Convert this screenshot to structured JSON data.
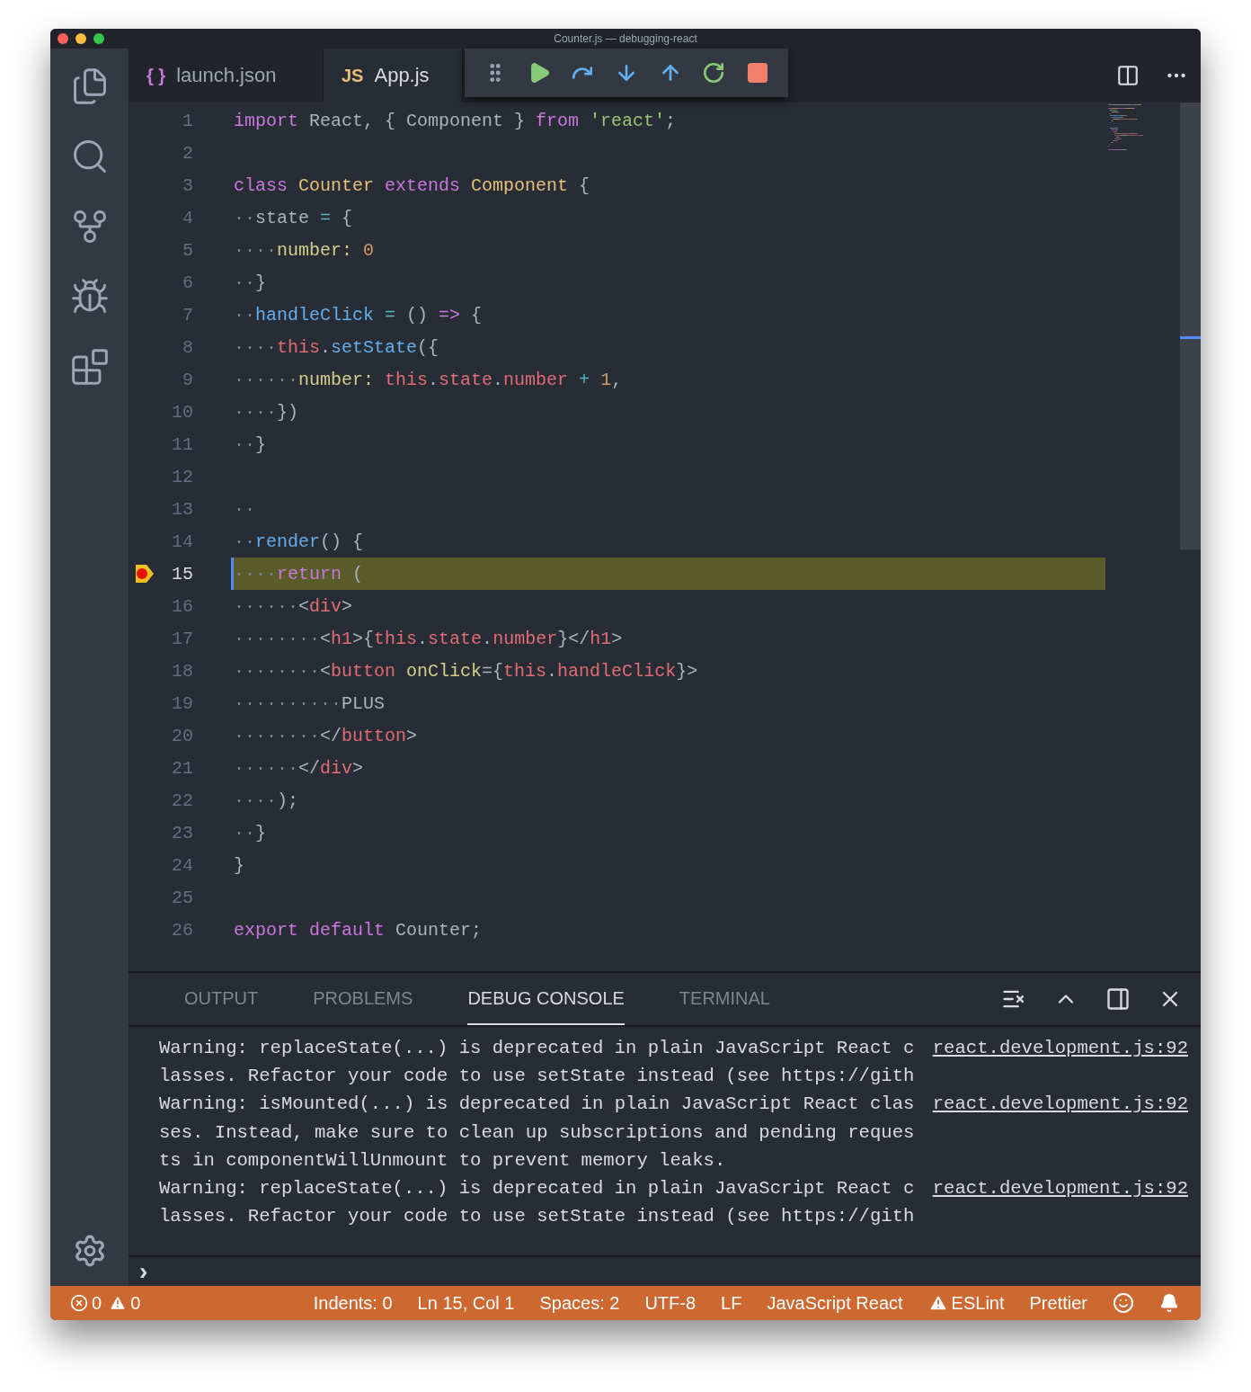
{
  "window": {
    "title": "Counter.js — debugging-react"
  },
  "activity_bar": {
    "items": [
      {
        "kind": "files",
        "selected": false
      },
      {
        "kind": "search",
        "selected": false
      },
      {
        "kind": "git",
        "selected": false
      },
      {
        "kind": "debug",
        "selected": false
      },
      {
        "kind": "extensions",
        "selected": false
      }
    ]
  },
  "tabs": [
    {
      "icon": "{ }",
      "label": "launch.json",
      "kind": "json",
      "selected": false
    },
    {
      "icon": "JS",
      "label": "App.js",
      "kind": "js",
      "selected": true
    }
  ],
  "debug_toolbar": [
    {
      "kind": "grip"
    },
    {
      "kind": "continue"
    },
    {
      "kind": "step-over"
    },
    {
      "kind": "step-into"
    },
    {
      "kind": "step-out"
    },
    {
      "kind": "restart"
    },
    {
      "kind": "stop"
    }
  ],
  "editor": {
    "lines": [
      {
        "number": "1",
        "breakpoint": false,
        "current": false,
        "tokens": [
          {
            "text": "import",
            "kind": "kw"
          },
          {
            "text": " React, { Component } ",
            "kind": "plain"
          },
          {
            "text": "from",
            "kind": "kw"
          },
          {
            "text": " 'react'",
            "kind": "str"
          },
          {
            "text": ";",
            "kind": "plain"
          }
        ]
      },
      {
        "number": "2",
        "breakpoint": false,
        "current": false
      },
      {
        "number": "3",
        "breakpoint": false,
        "current": false,
        "tokens": [
          {
            "text": "class",
            "kind": "kw"
          },
          {
            "text": " Counter",
            "kind": "cls"
          },
          {
            "text": " extends",
            "kind": "kw"
          },
          {
            "text": " Component",
            "kind": "cls"
          },
          {
            "text": " {",
            "kind": "plain"
          }
        ]
      },
      {
        "number": "4",
        "breakpoint": false,
        "current": false,
        "tokens": [
          {
            "text": "··",
            "kind": "ws"
          },
          {
            "text": "state ",
            "kind": "plain"
          },
          {
            "text": "=",
            "kind": "op"
          },
          {
            "text": " {",
            "kind": "plain"
          }
        ]
      },
      {
        "number": "5",
        "breakpoint": false,
        "current": false,
        "tokens": [
          {
            "text": "····",
            "kind": "ws"
          },
          {
            "text": "number: ",
            "kind": "prop"
          },
          {
            "text": "0",
            "kind": "num"
          }
        ]
      },
      {
        "number": "6",
        "breakpoint": false,
        "current": false,
        "tokens": [
          {
            "text": "··",
            "kind": "ws"
          },
          {
            "text": "}",
            "kind": "plain"
          }
        ]
      },
      {
        "number": "7",
        "breakpoint": false,
        "current": false,
        "tokens": [
          {
            "text": "··",
            "kind": "ws"
          },
          {
            "text": "handleClick",
            "kind": "fn"
          },
          {
            "text": " =",
            "kind": "op"
          },
          {
            "text": " () ",
            "kind": "plain"
          },
          {
            "text": "=>",
            "kind": "kw"
          },
          {
            "text": " {",
            "kind": "plain"
          }
        ]
      },
      {
        "number": "8",
        "breakpoint": false,
        "current": false,
        "tokens": [
          {
            "text": "····",
            "kind": "ws"
          },
          {
            "text": "this",
            "kind": "var"
          },
          {
            "text": ".",
            "kind": "plain"
          },
          {
            "text": "setState",
            "kind": "fn"
          },
          {
            "text": "({",
            "kind": "plain"
          }
        ]
      },
      {
        "number": "9",
        "breakpoint": false,
        "current": false,
        "tokens": [
          {
            "text": "······",
            "kind": "ws"
          },
          {
            "text": "number: ",
            "kind": "prop"
          },
          {
            "text": "this",
            "kind": "var"
          },
          {
            "text": ".",
            "kind": "plain"
          },
          {
            "text": "state",
            "kind": "var"
          },
          {
            "text": ".",
            "kind": "plain"
          },
          {
            "text": "number",
            "kind": "var"
          },
          {
            "text": " +",
            "kind": "op"
          },
          {
            "text": " 1",
            "kind": "num"
          },
          {
            "text": ",",
            "kind": "plain"
          }
        ]
      },
      {
        "number": "10",
        "breakpoint": false,
        "current": false,
        "tokens": [
          {
            "text": "····",
            "kind": "ws"
          },
          {
            "text": "})",
            "kind": "plain"
          }
        ]
      },
      {
        "number": "11",
        "breakpoint": false,
        "current": false,
        "tokens": [
          {
            "text": "··",
            "kind": "ws"
          },
          {
            "text": "}",
            "kind": "plain"
          }
        ]
      },
      {
        "number": "12",
        "breakpoint": false,
        "current": false
      },
      {
        "number": "13",
        "breakpoint": false,
        "current": false,
        "tokens": [
          {
            "text": "··",
            "kind": "ws"
          }
        ]
      },
      {
        "number": "14",
        "breakpoint": false,
        "current": false,
        "tokens": [
          {
            "text": "··",
            "kind": "ws"
          },
          {
            "text": "render",
            "kind": "fn"
          },
          {
            "text": "() {",
            "kind": "plain"
          }
        ]
      },
      {
        "number": "15",
        "breakpoint": true,
        "current": true,
        "tokens": [
          {
            "text": "····",
            "kind": "ws"
          },
          {
            "text": "return",
            "kind": "kw"
          },
          {
            "text": " (",
            "kind": "plain"
          }
        ]
      },
      {
        "number": "16",
        "breakpoint": false,
        "current": false,
        "tokens": [
          {
            "text": "······",
            "kind": "ws"
          },
          {
            "text": "<",
            "kind": "plain"
          },
          {
            "text": "div",
            "kind": "var"
          },
          {
            "text": ">",
            "kind": "plain"
          }
        ]
      },
      {
        "number": "17",
        "breakpoint": false,
        "current": false,
        "tokens": [
          {
            "text": "········",
            "kind": "ws"
          },
          {
            "text": "<",
            "kind": "plain"
          },
          {
            "text": "h1",
            "kind": "var"
          },
          {
            "text": ">{",
            "kind": "plain"
          },
          {
            "text": "this",
            "kind": "var"
          },
          {
            "text": ".",
            "kind": "plain"
          },
          {
            "text": "state",
            "kind": "var"
          },
          {
            "text": ".",
            "kind": "plain"
          },
          {
            "text": "number",
            "kind": "var"
          },
          {
            "text": "}</",
            "kind": "plain"
          },
          {
            "text": "h1",
            "kind": "var"
          },
          {
            "text": ">",
            "kind": "plain"
          }
        ]
      },
      {
        "number": "18",
        "breakpoint": false,
        "current": false,
        "tokens": [
          {
            "text": "········",
            "kind": "ws"
          },
          {
            "text": "<",
            "kind": "plain"
          },
          {
            "text": "button",
            "kind": "var"
          },
          {
            "text": " onClick",
            "kind": "prop"
          },
          {
            "text": "={",
            "kind": "plain"
          },
          {
            "text": "this",
            "kind": "var"
          },
          {
            "text": ".",
            "kind": "plain"
          },
          {
            "text": "handleClick",
            "kind": "var"
          },
          {
            "text": "}>",
            "kind": "plain"
          }
        ]
      },
      {
        "number": "19",
        "breakpoint": false,
        "current": false,
        "tokens": [
          {
            "text": "··········",
            "kind": "ws"
          },
          {
            "text": "PLUS",
            "kind": "plain"
          }
        ]
      },
      {
        "number": "20",
        "breakpoint": false,
        "current": false,
        "tokens": [
          {
            "text": "········",
            "kind": "ws"
          },
          {
            "text": "</",
            "kind": "plain"
          },
          {
            "text": "button",
            "kind": "var"
          },
          {
            "text": ">",
            "kind": "plain"
          }
        ]
      },
      {
        "number": "21",
        "breakpoint": false,
        "current": false,
        "tokens": [
          {
            "text": "······",
            "kind": "ws"
          },
          {
            "text": "</",
            "kind": "plain"
          },
          {
            "text": "div",
            "kind": "var"
          },
          {
            "text": ">",
            "kind": "plain"
          }
        ]
      },
      {
        "number": "22",
        "breakpoint": false,
        "current": false,
        "tokens": [
          {
            "text": "····",
            "kind": "ws"
          },
          {
            "text": ");",
            "kind": "plain"
          }
        ]
      },
      {
        "number": "23",
        "breakpoint": false,
        "current": false,
        "tokens": [
          {
            "text": "··",
            "kind": "ws"
          },
          {
            "text": "}",
            "kind": "plain"
          }
        ]
      },
      {
        "number": "24",
        "breakpoint": false,
        "current": false,
        "tokens": [
          {
            "text": "}",
            "kind": "plain"
          }
        ]
      },
      {
        "number": "25",
        "breakpoint": false,
        "current": false
      },
      {
        "number": "26",
        "breakpoint": false,
        "current": false,
        "tokens": [
          {
            "text": "export",
            "kind": "kw"
          },
          {
            "text": " default",
            "kind": "kw"
          },
          {
            "text": " Counter;",
            "kind": "plain"
          }
        ]
      }
    ]
  },
  "panel": {
    "tabs": [
      {
        "label": "OUTPUT",
        "selected": false
      },
      {
        "label": "PROBLEMS",
        "selected": false
      },
      {
        "label": "DEBUG CONSOLE",
        "selected": true
      },
      {
        "label": "TERMINAL",
        "selected": false
      }
    ],
    "actions": [
      {
        "kind": "clear"
      },
      {
        "kind": "maximize"
      },
      {
        "kind": "layout"
      },
      {
        "kind": "close"
      }
    ],
    "messages": [
      {
        "text": "Warning: replaceState(...) is deprecated in plain JavaScript React classes. Refactor your code to use setState instead (see https://gith",
        "source": "react.development.js:92"
      },
      {
        "text": "Warning: isMounted(...) is deprecated in plain JavaScript React classes. Instead, make sure to clean up subscriptions and pending requests in componentWillUnmount to prevent memory leaks.",
        "source": "react.development.js:92"
      },
      {
        "text": "Warning: replaceState(...) is deprecated in plain JavaScript React classes. Refactor your code to use setState instead (see https://gith",
        "source": "react.development.js:92"
      }
    ],
    "prompt": "›"
  },
  "status_bar": {
    "errors": "0",
    "warnings": "0",
    "items": [
      {
        "label": "Indents: 0",
        "kind": "text"
      },
      {
        "label": "Ln 15, Col 1",
        "kind": "text"
      },
      {
        "label": "Spaces: 2",
        "kind": "text"
      },
      {
        "label": "UTF-8",
        "kind": "text"
      },
      {
        "label": "LF",
        "kind": "text"
      },
      {
        "label": "JavaScript React",
        "kind": "text"
      },
      {
        "label": "ESLint",
        "kind": "warning"
      },
      {
        "label": "Prettier",
        "kind": "text"
      },
      {
        "kind": "smiley"
      },
      {
        "kind": "bell"
      }
    ]
  }
}
